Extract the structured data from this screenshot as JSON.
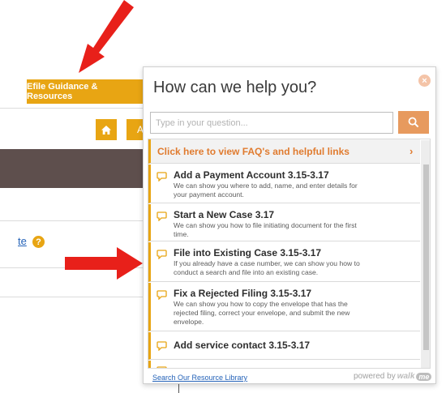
{
  "background": {
    "efile_button": "Efile Guidance & Resources",
    "a_button": "A",
    "link_fragment": "te",
    "help_badge": "?"
  },
  "widget": {
    "title": "How can we help you?",
    "close": "×",
    "search": {
      "placeholder": "Type in your question..."
    },
    "faq": {
      "label": "Click here to view FAQ's and helpful links",
      "chevron": "›"
    },
    "items": [
      {
        "title": "Add a Payment Account 3.15-3.17",
        "desc": "We can show you where to add, name, and enter details for your payment account."
      },
      {
        "title": "Start a New Case 3.17",
        "desc": "We can show you how to file initiating document for the first time."
      },
      {
        "title": "File into Existing Case 3.15-3.17",
        "desc": "If you already have a case number, we can show you how to conduct a search and file into an existing case."
      },
      {
        "title": "Fix a Rejected Filing 3.15-3.17",
        "desc": "We can show you how to copy the envelope that has the rejected filing, correct your envelope, and submit the new envelope."
      },
      {
        "title": "Add service contact 3.15-3.17",
        "desc": ""
      }
    ],
    "footer": {
      "resource_link": "Search Our Resource Library",
      "powered_by": "powered by",
      "brand_walk": "walk",
      "brand_me": "me"
    }
  },
  "colors": {
    "accent": "#e8a513",
    "faq_text": "#e07b2f",
    "search_button": "#e79a5e",
    "arrow": "#e8201a",
    "link": "#2462b8"
  },
  "icons": [
    "home-icon",
    "search-icon",
    "close-icon",
    "chevron-right-icon",
    "chat-bubble-icon",
    "help-icon"
  ]
}
